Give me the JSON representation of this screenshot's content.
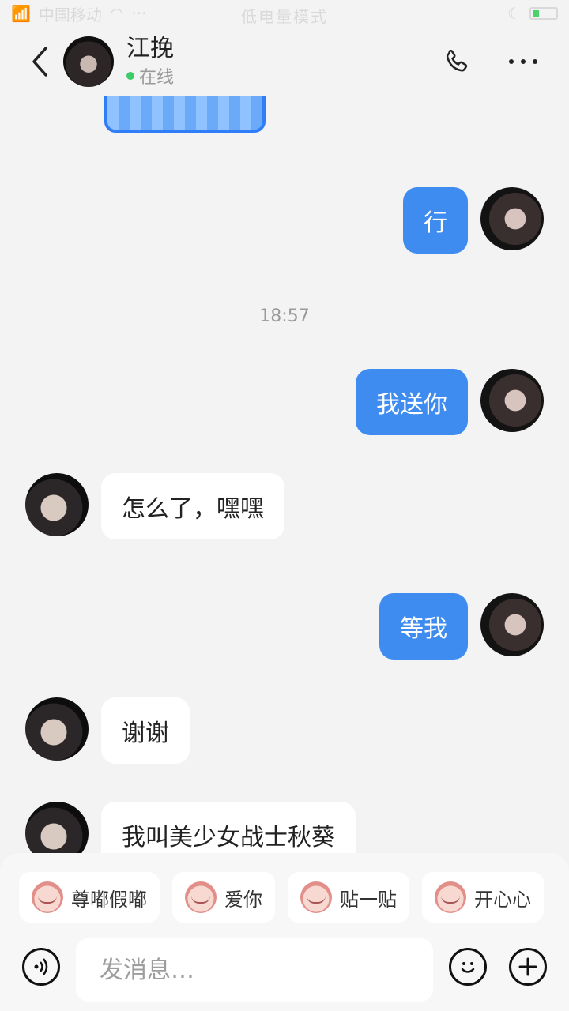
{
  "status_bar": {
    "carrier": "中国移动",
    "center_text": "低电量模式"
  },
  "header": {
    "name": "江挽",
    "status": "在线"
  },
  "messages": [
    {
      "side": "me",
      "text": "行"
    },
    {
      "timestamp": "18:57"
    },
    {
      "side": "me",
      "text": "我送你"
    },
    {
      "side": "them",
      "text": "怎么了，嘿嘿"
    },
    {
      "side": "me",
      "text": "等我"
    },
    {
      "side": "them",
      "text": "谢谢"
    },
    {
      "side": "them",
      "text": "我叫美少女战士秋葵"
    }
  ],
  "quick_replies": [
    "尊嘟假嘟",
    "爱你",
    "贴一贴",
    "开心心"
  ],
  "input": {
    "placeholder": "发消息…"
  }
}
